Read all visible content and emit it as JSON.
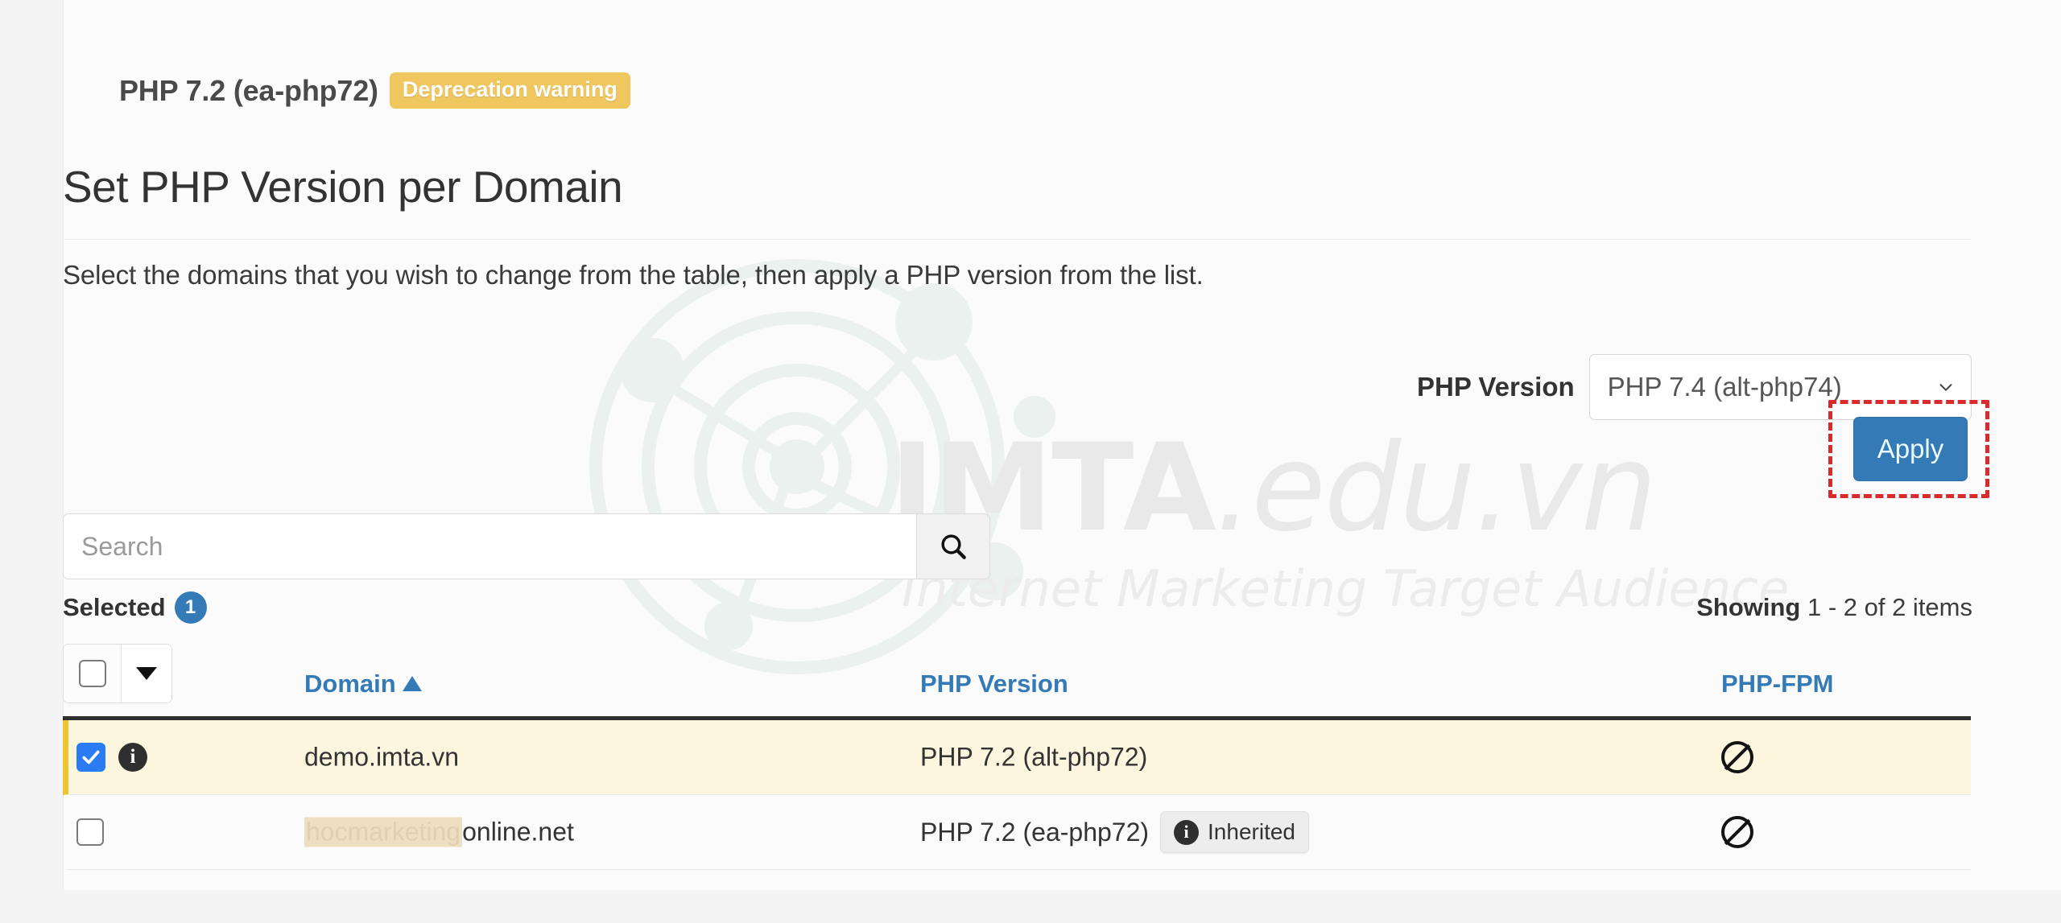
{
  "php_header": {
    "version_text": "PHP 7.2 (ea-php72)",
    "badge": "Deprecation warning"
  },
  "page": {
    "title": "Set PHP Version per Domain",
    "subtitle": "Select the domains that you wish to change from the table, then apply a PHP version from the list."
  },
  "version_control": {
    "label": "PHP Version",
    "selected": "PHP 7.4 (alt-php74)",
    "apply_label": "Apply",
    "apply_color": "#337ab7",
    "highlight_color": "#d92b2b"
  },
  "search": {
    "placeholder": "Search",
    "value": "",
    "icon": "search-icon"
  },
  "selection": {
    "label": "Selected",
    "count": "1",
    "badge_color": "#337ab7"
  },
  "showing": {
    "prefix": "Showing",
    "range": " 1 - 2 of 2 items"
  },
  "table": {
    "columns": {
      "domain": "Domain",
      "php_version": "PHP Version",
      "php_fpm": "PHP-FPM"
    },
    "sort": {
      "column": "Domain",
      "direction": "ascending",
      "glyph": "▲"
    },
    "header_color": "#337ab7",
    "rows": [
      {
        "selected": true,
        "checkbox_state": "checked",
        "has_info_icon": true,
        "domain": "demo.imta.vn",
        "domain_redacted": "",
        "php_version": "PHP 7.2 (alt-php72)",
        "inherited": false,
        "inherited_label": "",
        "php_fpm": "disabled",
        "php_fpm_icon": "prohibited-icon",
        "highlight_color": "#fdf6df",
        "accent_color": "#edc531"
      },
      {
        "selected": false,
        "checkbox_state": "unchecked",
        "has_info_icon": false,
        "domain": "online.net",
        "domain_redacted": "hocmarketing",
        "php_version": "PHP 7.2 (ea-php72)",
        "inherited": true,
        "inherited_label": "Inherited",
        "php_fpm": "disabled",
        "php_fpm_icon": "prohibited-icon",
        "highlight_color": "",
        "accent_color": ""
      }
    ]
  },
  "watermark": {
    "brand_main": "IMTA",
    "brand_suffix": ".edu.vn",
    "tagline": "Internet Marketing Target Audience"
  }
}
